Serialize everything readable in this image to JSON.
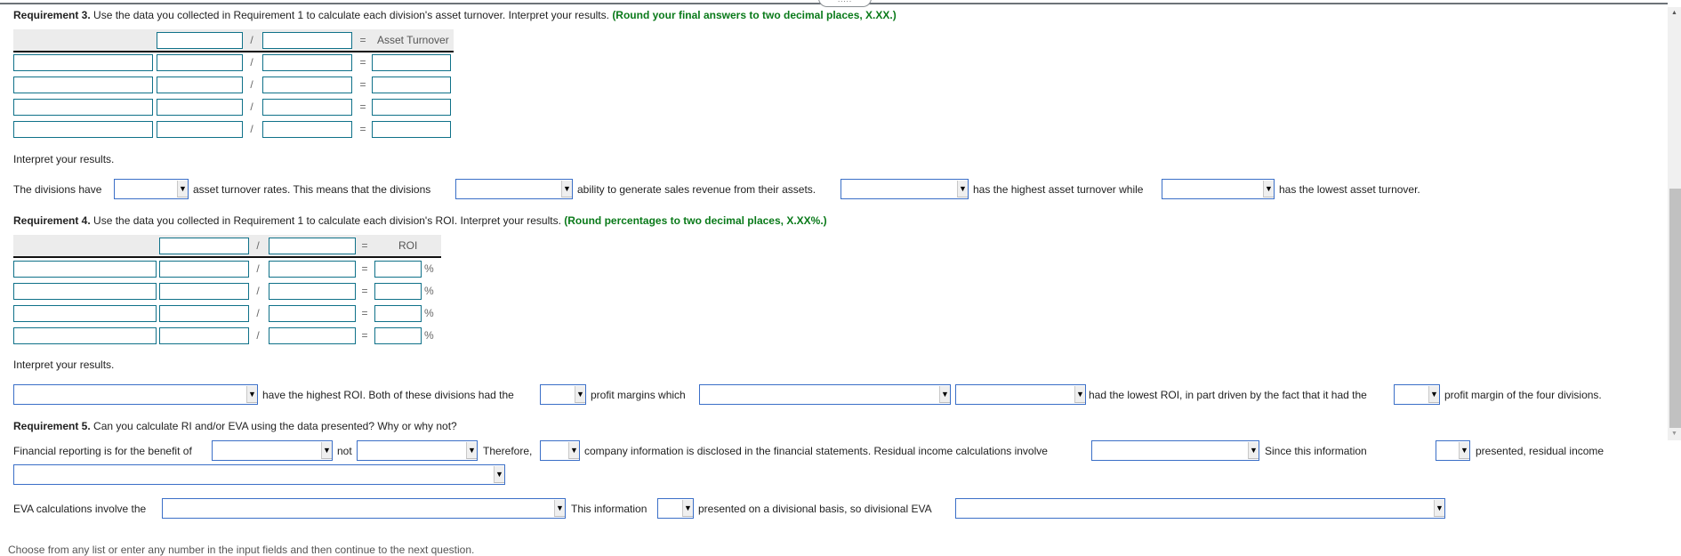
{
  "req3": {
    "title_bold": "Requirement 3.",
    "title_text": " Use the data you collected in Requirement 1 to calculate each division's asset turnover. Interpret your results. ",
    "instruction": "(Round your final answers to two decimal places, X.XX.)",
    "divide_op": "/",
    "equals_op": "=",
    "result_header": "Asset Turnover",
    "rows": 4,
    "interpret_label": "Interpret your results.",
    "sentence": {
      "s1": "The divisions have",
      "s2": "asset turnover rates. This means that the divisions",
      "s3": "ability to generate sales revenue from their assets.",
      "s4": "has the highest asset turnover while",
      "s5": "has the lowest asset turnover."
    }
  },
  "req4": {
    "title_bold": "Requirement 4.",
    "title_text": " Use the data you collected in Requirement 1 to calculate each division's ROI. Interpret your results. ",
    "instruction": "(Round percentages to two decimal places, X.XX%.)",
    "divide_op": "/",
    "equals_op": "=",
    "result_header": "ROI",
    "percent": "%",
    "interpret_label": "Interpret your results.",
    "sentence": {
      "s1": "have the highest ROI. Both of these divisions had the",
      "s2": "profit margins which",
      "s3": "had the lowest ROI, in part driven by the fact that it had the",
      "s4": "profit margin of the four divisions."
    }
  },
  "req5": {
    "title_bold": "Requirement 5.",
    "title_text": " Can you calculate RI and/or EVA using the data presented? Why or why not?",
    "sentence": {
      "s1": "Financial reporting is for the benefit of",
      "s2": "not",
      "s3": "Therefore,",
      "s4": "company information is disclosed in the financial statements. Residual income calculations involve",
      "s5": "Since this information",
      "s6": "presented, residual income",
      "s7": "EVA calculations involve the",
      "s8": "This information",
      "s9": "presented on a divisional basis, so divisional EVA"
    }
  },
  "dropdown_arrow": "▼",
  "footer": "Choose from any list or enter any number in the input fields and then continue to the next question.",
  "drag_handle": ".....",
  "scrollbar": {
    "up": "▲",
    "down": "▼"
  }
}
